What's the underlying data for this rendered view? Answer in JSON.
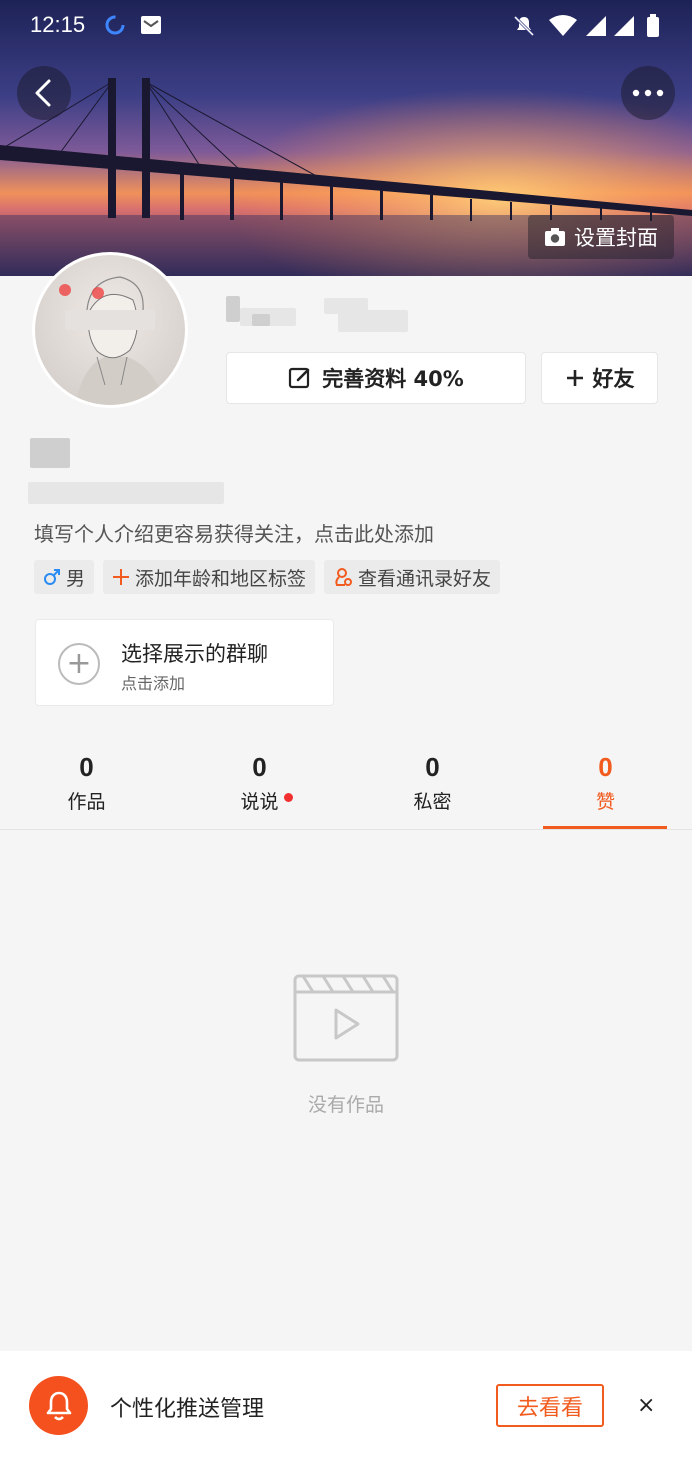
{
  "status_bar": {
    "time": "12:15"
  },
  "header": {
    "set_cover_label": "设置封面"
  },
  "profile": {
    "edit_profile_label": "完善资料 40%",
    "add_friend_label": "好友",
    "intro_placeholder": "填写个人介绍更容易获得关注，点击此处添加",
    "tags": [
      {
        "icon": "male-icon",
        "label": "男"
      },
      {
        "icon": "plus-icon",
        "label": "添加年龄和地区标签"
      },
      {
        "icon": "contacts-icon",
        "label": "查看通讯录好友"
      }
    ],
    "group_chat": {
      "title": "选择展示的群聊",
      "subtitle": "点击添加"
    }
  },
  "tabs": [
    {
      "count": "0",
      "label": "作品",
      "active": false,
      "dot": false
    },
    {
      "count": "0",
      "label": "说说",
      "active": false,
      "dot": true
    },
    {
      "count": "0",
      "label": "私密",
      "active": false,
      "dot": false
    },
    {
      "count": "0",
      "label": "赞",
      "active": true,
      "dot": false
    }
  ],
  "empty_state": {
    "label": "没有作品"
  },
  "bottom_bar": {
    "title": "个性化推送管理",
    "action_label": "去看看",
    "close_symbol": "×"
  },
  "colors": {
    "accent": "#f25b1e",
    "bell_bg": "#f4511e"
  }
}
